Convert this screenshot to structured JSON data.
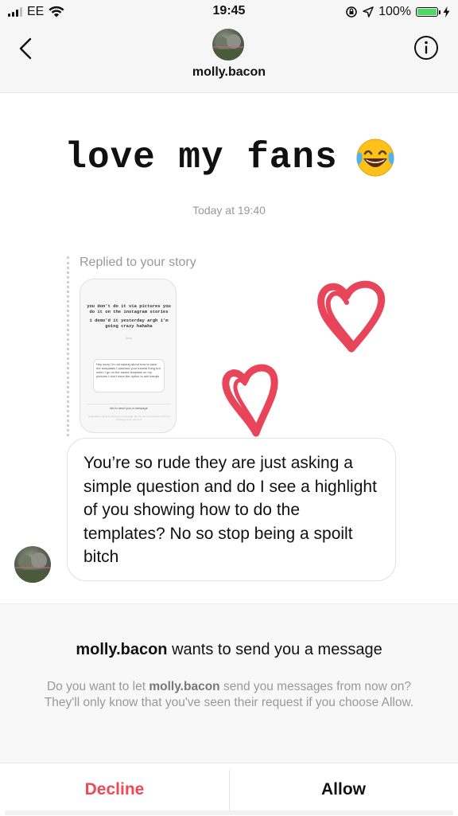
{
  "status_bar": {
    "carrier": "EE",
    "time": "19:45",
    "battery_percent": "100%",
    "battery_level": 1.0,
    "icons": [
      "signal-icon",
      "wifi-icon",
      "orientation-lock-icon",
      "location-icon",
      "battery-icon",
      "charging-icon"
    ]
  },
  "header": {
    "username": "molly.bacon",
    "icons": [
      "back-icon",
      "info-icon"
    ]
  },
  "conversation": {
    "big_message": "love my fans",
    "big_message_emoji": "laughing-tears-emoji",
    "timestamp": "Today at 19:40",
    "replied_label": "Replied to your story",
    "story": {
      "text_line1": "you don't do it via pictures you do it on the instagram stories",
      "text_line2": "i demo'd it yesterday argh i'm going crazy hahaha",
      "seen_small": "Seen",
      "card_text": "Hey sorry I'm not asking about how to save the templates I watched your tutorial thing but when I go on the saved template on my pictures I don't have the option to add emojis",
      "send_text": "ids to send you a message",
      "footer_text": "molly.bacon wants to send you a message. Do you want to let them send you messages from now on?"
    },
    "message": "You’re so rude they are just asking a simple question and do I see a highlight of you showing how to do the templates? No so stop being a spoilt bitch",
    "heart_color": "#e8445a"
  },
  "request": {
    "title_user": "molly.bacon",
    "title_rest": " wants to send you a message",
    "body_pre": "Do you want to let ",
    "body_user": "molly.bacon",
    "body_post": " send you messages from now on? They'll only know that you've seen their request if you choose Allow.",
    "decline_label": "Decline",
    "allow_label": "Allow",
    "decline_color": "#ed4956"
  }
}
